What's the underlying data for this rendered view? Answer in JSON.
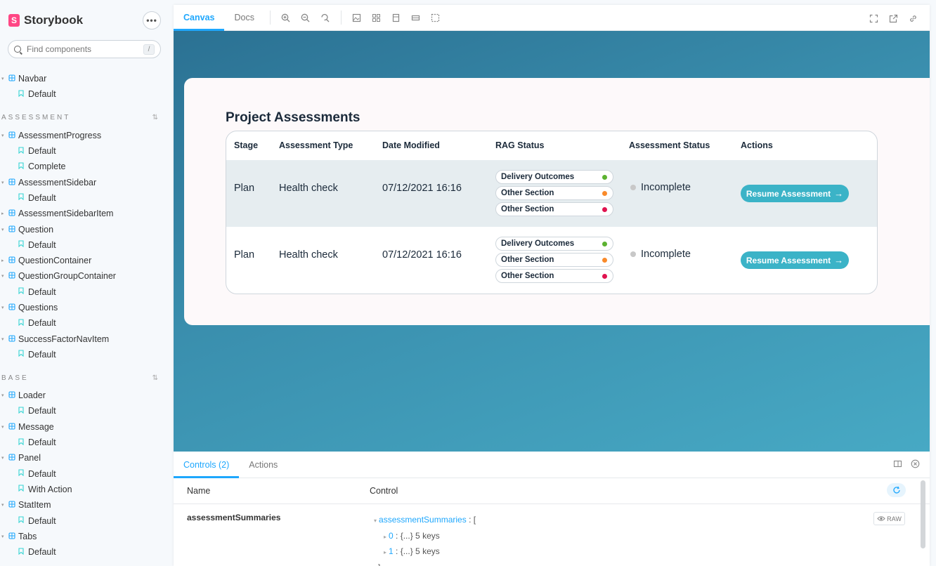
{
  "app": {
    "name": "Storybook",
    "logo_letter": "S",
    "menu_label": "•••"
  },
  "search": {
    "placeholder": "Find components",
    "shortcut": "/"
  },
  "sidebar": {
    "rows": [
      {
        "kind": "comp",
        "label": "Navbar"
      },
      {
        "kind": "story",
        "label": "Default"
      },
      {
        "kind": "group",
        "label": "ASSESSMENT",
        "toggle": "⌃⌄"
      },
      {
        "kind": "comp",
        "label": "AssessmentProgress"
      },
      {
        "kind": "story",
        "label": "Default"
      },
      {
        "kind": "story",
        "label": "Complete"
      },
      {
        "kind": "comp",
        "label": "AssessmentSidebar"
      },
      {
        "kind": "story",
        "label": "Default"
      },
      {
        "kind": "comp-collapsed",
        "label": "AssessmentSidebarItem"
      },
      {
        "kind": "comp",
        "label": "Question"
      },
      {
        "kind": "story",
        "label": "Default"
      },
      {
        "kind": "comp-collapsed",
        "label": "QuestionContainer"
      },
      {
        "kind": "comp",
        "label": "QuestionGroupContainer"
      },
      {
        "kind": "story",
        "label": "Default"
      },
      {
        "kind": "comp",
        "label": "Questions"
      },
      {
        "kind": "story",
        "label": "Default"
      },
      {
        "kind": "comp",
        "label": "SuccessFactorNavItem"
      },
      {
        "kind": "story",
        "label": "Default"
      },
      {
        "kind": "group",
        "label": "BASE",
        "toggle": "✕"
      },
      {
        "kind": "comp",
        "label": "Loader"
      },
      {
        "kind": "story",
        "label": "Default"
      },
      {
        "kind": "comp",
        "label": "Message"
      },
      {
        "kind": "story",
        "label": "Default"
      },
      {
        "kind": "comp",
        "label": "Panel"
      },
      {
        "kind": "story",
        "label": "Default"
      },
      {
        "kind": "story",
        "label": "With Action"
      },
      {
        "kind": "comp",
        "label": "StatItem"
      },
      {
        "kind": "story",
        "label": "Default"
      },
      {
        "kind": "comp",
        "label": "Tabs"
      },
      {
        "kind": "story",
        "label": "Default"
      }
    ]
  },
  "toolbar": {
    "tab_canvas": "Canvas",
    "tab_docs": "Docs"
  },
  "assessments": {
    "title": "Project Assessments",
    "headers": {
      "stage": "Stage",
      "type": "Assessment Type",
      "date": "Date Modified",
      "rag": "RAG Status",
      "status": "Assessment Status",
      "actions": "Actions"
    },
    "rows": [
      {
        "stage": "Plan",
        "type": "Health check",
        "date": "07/12/2021 16:16",
        "rag": [
          {
            "label": "Delivery Outcomes",
            "color": "#5cb230"
          },
          {
            "label": "Other Section",
            "color": "#f98a2a"
          },
          {
            "label": "Other Section",
            "color": "#e0134f"
          }
        ],
        "status": "Incomplete",
        "action": "Resume Assessment"
      },
      {
        "stage": "Plan",
        "type": "Health check",
        "date": "07/12/2021 16:16",
        "rag": [
          {
            "label": "Delivery Outcomes",
            "color": "#5cb230"
          },
          {
            "label": "Other Section",
            "color": "#f98a2a"
          },
          {
            "label": "Other Section",
            "color": "#e0134f"
          }
        ],
        "status": "Incomplete",
        "action": "Resume Assessment"
      }
    ]
  },
  "addons": {
    "tab_controls": "Controls (2)",
    "tab_actions": "Actions",
    "col_name": "Name",
    "col_control": "Control",
    "prop_name": "assessmentSummaries",
    "json_key": "assessmentSummaries",
    "json_open": " : [",
    "item0_index": "0",
    "item0_value": " : {...} 5 keys",
    "item1_index": "1",
    "item1_value": " : {...} 5 keys",
    "json_close": "]",
    "raw_label": "RAW"
  },
  "colors": {
    "accent": "#1ea7fd",
    "button": "#3bb3c7",
    "brand": "#ff4785"
  }
}
